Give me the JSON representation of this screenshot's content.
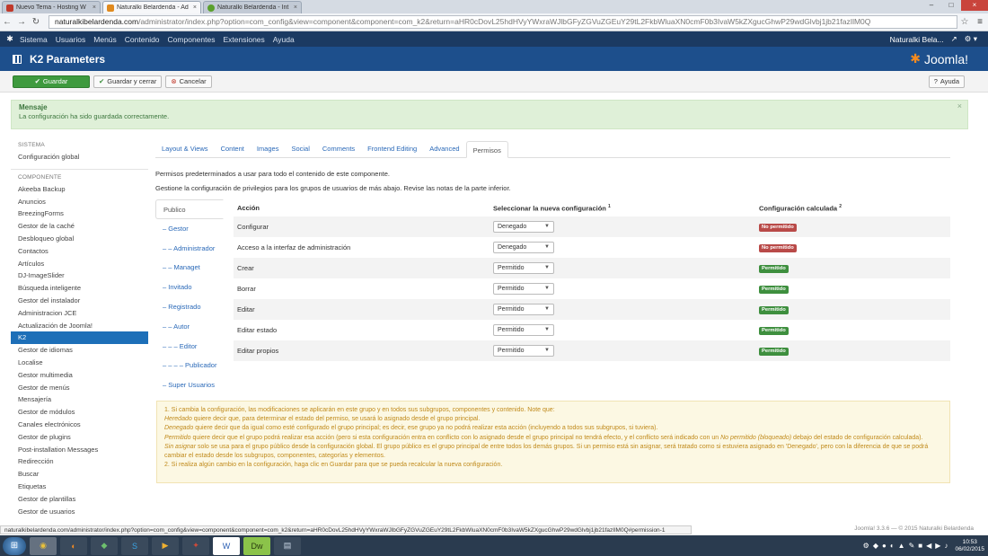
{
  "browser": {
    "tabs": [
      {
        "title": "Nuevo Tema - Hosting W",
        "favicon_color": "#c0392b",
        "active": false
      },
      {
        "title": "Naturalki Belardenda - Ad",
        "favicon_color": "#e08a1e",
        "active": true
      },
      {
        "title": "Naturalki Belardenda - Int",
        "favicon_color": "#5aa02c",
        "active": false
      }
    ],
    "url_host": "naturalkibelardenda.com",
    "url_path": "/administrator/index.php?option=com_config&view=component&component=com_k2&return=aHR0cDovL25hdHVyYWxraWJlbGFyZGVuZGEuY29tL2FkbWluaXN0cmF0b3IvaW5kZXgucGhwP29wdGlvbj1jb21fazIlM0Q",
    "status_url": "naturalkibelardenda.com/administrator/index.php?option=com_config&view=component&component=com_k2&return=aHR0cDovL25hdHVyYWxraWJlbGFyZGVuZGEuY29tL2FkbWluaXN0cmF0b3IvaW5kZXgucGhwP29wdGlvbj1jb21fazIlM0Q#permission-1"
  },
  "nav": {
    "items": [
      "Sistema",
      "Usuarios",
      "Menús",
      "Contenido",
      "Componentes",
      "Extensiones",
      "Ayuda"
    ],
    "user": "Naturalki Bela...",
    "ext_icon": "↗",
    "gear_icon": "⚙ ▾"
  },
  "header": {
    "title": "K2 Parameters",
    "brand": "Joomla!",
    "brand_glyph": "✱"
  },
  "toolbar": {
    "save": "Guardar",
    "save_close": "Guardar y cerrar",
    "cancel": "Cancelar",
    "help": "Ayuda"
  },
  "message": {
    "heading": "Mensaje",
    "text": "La configuración ha sido guardada correctamente.",
    "close": "×"
  },
  "sidebar": {
    "sistema_heading": "SISTEMA",
    "sistema_items": [
      "Configuración global"
    ],
    "componente_heading": "COMPONENTE",
    "items": [
      "Akeeba Backup",
      "Anuncios",
      "BreezingForms",
      "Gestor de la caché",
      "Desbloqueo global",
      "Contactos",
      "Artículos",
      "DJ-ImageSlider",
      "Búsqueda inteligente",
      "Gestor del instalador",
      "Administracion JCE",
      "Actualización de Joomla!",
      "K2",
      "Gestor de idiomas",
      "Localise",
      "Gestor multimedia",
      "Gestor de menús",
      "Mensajería",
      "Gestor de módulos",
      "Canales electrónicos",
      "Gestor de plugins",
      "Post-installation Messages",
      "Redirección",
      "Buscar",
      "Etiquetas",
      "Gestor de plantillas",
      "Gestor de usuarios"
    ],
    "active_index": 12
  },
  "tabs": [
    "Layout & Views",
    "Content",
    "Images",
    "Social",
    "Comments",
    "Frontend Editing",
    "Advanced",
    "Permisos"
  ],
  "active_tab": 7,
  "intro": {
    "line1": "Permisos predeterminados a usar para todo el contenido de este componente.",
    "line2": "Gestione la configuración de privilegios para los grupos de usuarios de más abajo. Revise las notas de la parte inferior."
  },
  "groups": [
    "Publico",
    "– Gestor",
    "– – Administrador",
    "– – Managet",
    "– Invitado",
    "– Registrado",
    "– – Autor",
    "– – – Editor",
    "– – – – Publicador",
    "– Super Usuarios"
  ],
  "active_group": 0,
  "table": {
    "col_action": "Acción",
    "col_new": "Seleccionar la nueva configuración",
    "col_new_sup": "1",
    "col_calc": "Configuración calculada",
    "col_calc_sup": "2",
    "rows": [
      {
        "action": "Configurar",
        "select": "Denegado",
        "result": "No permitido",
        "status_color": "#b94a48"
      },
      {
        "action": "Acceso a la interfaz de administración",
        "select": "Denegado",
        "result": "No permitido",
        "status_color": "#b94a48"
      },
      {
        "action": "Crear",
        "select": "Permitido",
        "result": "Permitido",
        "status_color": "#3e8f3e"
      },
      {
        "action": "Borrar",
        "select": "Permitido",
        "result": "Permitido",
        "status_color": "#3e8f3e"
      },
      {
        "action": "Editar",
        "select": "Permitido",
        "result": "Permitido",
        "status_color": "#3e8f3e"
      },
      {
        "action": "Editar estado",
        "select": "Permitido",
        "result": "Permitido",
        "status_color": "#3e8f3e"
      },
      {
        "action": "Editar propios",
        "select": "Permitido",
        "result": "Permitido",
        "status_color": "#3e8f3e"
      }
    ]
  },
  "notes": {
    "n1": "1. Si cambia la configuración, las modificaciones se aplicarán en este grupo y en todos sus subgrupos, componentes y contenido. Note que:",
    "heredado_term": "Heredado",
    "heredado": " quiere decir que, para determinar el estado del permiso, se usará lo asignado desde el grupo principal.",
    "denegado_term": "Denegado",
    "denegado": " quiere decir que da igual como esté configurado el grupo principal; es decir, ese grupo ya no podrá realizar esta acción (incluyendo a todos sus subgrupos, si tuviera).",
    "permitido_term": "Permitido",
    "permitido_a": " quiere decir que el grupo podrá realizar esa acción (pero si esta configuración entra en conflicto con lo asignado desde el grupo principal no tendrá efecto, y el conflicto será indicado con un ",
    "permitido_em": "No permitido (bloqueado)",
    "permitido_b": " debajo del estado de configuración calculada).",
    "sinasignar_term": "Sin asignar",
    "sinasignar": " solo se usa para el grupo público desde la configuración global. El grupo público es el grupo principal de entre todos los demás grupos. Si un permiso está sin asignar, será tratado como si estuviera asignado en 'Denegado', pero con la diferencia de que se podrá cambiar el estado desde los subgrupos, componentes, categorías y elementos.",
    "n2": "2. Si realiza algún cambio en la configuración, haga clic en Guardar para que se pueda recalcular la nueva configuración."
  },
  "footer": "Joomla! 3.3.6 — © 2015 Naturalki Belardenda",
  "taskbar": {
    "apps": [
      "Chrome",
      "Firefox",
      "Network",
      "Skype",
      "Media",
      "Tools",
      "Word",
      "Dreamweaver",
      "Files"
    ],
    "time": "10:53",
    "date": "06/02/2015",
    "tray_icons": [
      "⚙",
      "◆",
      "●",
      "◐",
      "▲",
      "✎",
      "■",
      "◀",
      "▶",
      "♪"
    ]
  }
}
